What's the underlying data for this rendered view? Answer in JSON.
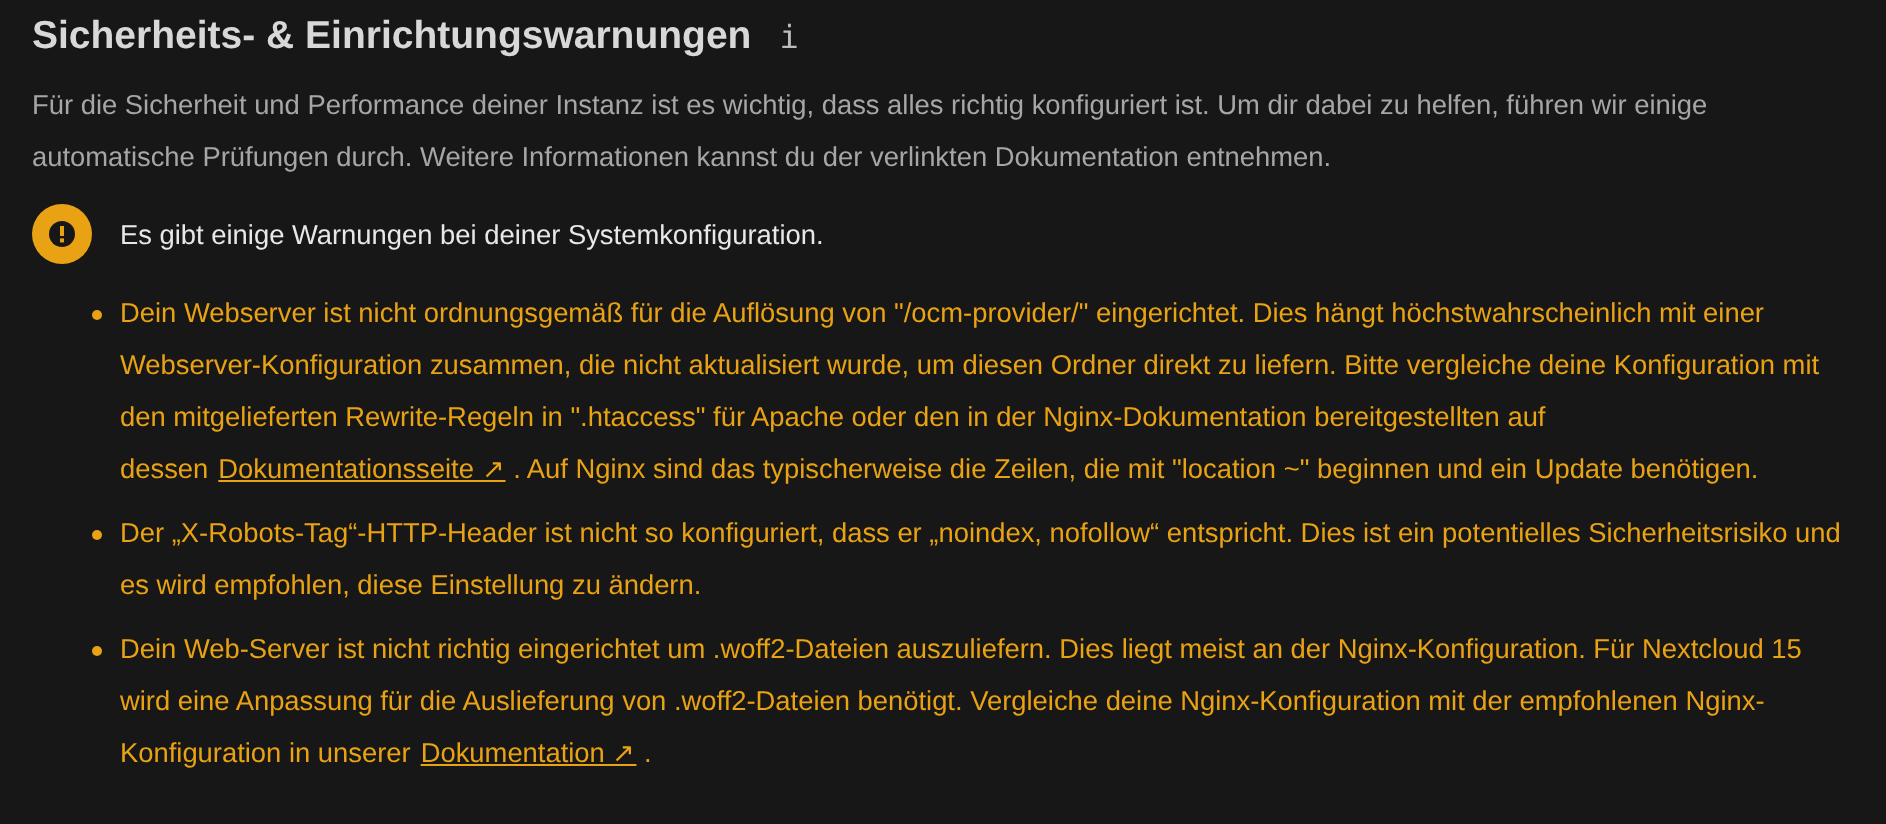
{
  "section": {
    "title": "Sicherheits- & Einrichtungswarnungen",
    "info_icon": "i",
    "intro": "Für die Sicherheit und Performance deiner Instanz ist es wichtig, dass alles richtig konfiguriert ist. Um dir dabei zu helfen, führen wir einige automatische Prüfungen durch. Weitere Informationen kannst du der verlinkten Dokumentation entnehmen."
  },
  "status": {
    "message": "Es gibt einige Warnungen bei deiner Systemkonfiguration."
  },
  "warnings": [
    {
      "text": "Dein Webserver ist nicht ordnungsgemäß für die Auflösung von \"/ocm-provider/\" eingerichtet. Dies hängt höchstwahrscheinlich mit einer Webserver-Konfiguration zusammen, die nicht aktualisiert wurde, um diesen Ordner direkt zu liefern. Bitte vergleiche deine Konfiguration mit den mitgelieferten Rewrite-Regeln in \".htaccess\" für Apache oder den in der Nginx-Dokumentation bereitgestellten auf dessen",
      "link": "Dokumentationsseite ↗",
      "text_after": ". Auf Nginx sind das typischerweise die Zeilen, die mit \"location ~\" beginnen und ein Update benötigen."
    },
    {
      "text": "Der „X-Robots-Tag“-HTTP-Header ist nicht so konfiguriert, dass er „noindex, nofollow“ entspricht. Dies ist ein potentielles Sicherheitsrisiko und es wird empfohlen, diese Einstellung zu ändern."
    },
    {
      "text": "Dein Web-Server ist nicht richtig eingerichtet um .woff2-Dateien auszuliefern. Dies liegt meist an der Nginx-Konfiguration. Für Nextcloud 15 wird eine Anpassung für die Auslieferung von .woff2-Dateien benötigt. Vergleiche deine Nginx-Konfiguration mit der empfohlenen Nginx-Konfiguration in unserer",
      "link": "Dokumentation ↗",
      "text_after": "."
    }
  ]
}
